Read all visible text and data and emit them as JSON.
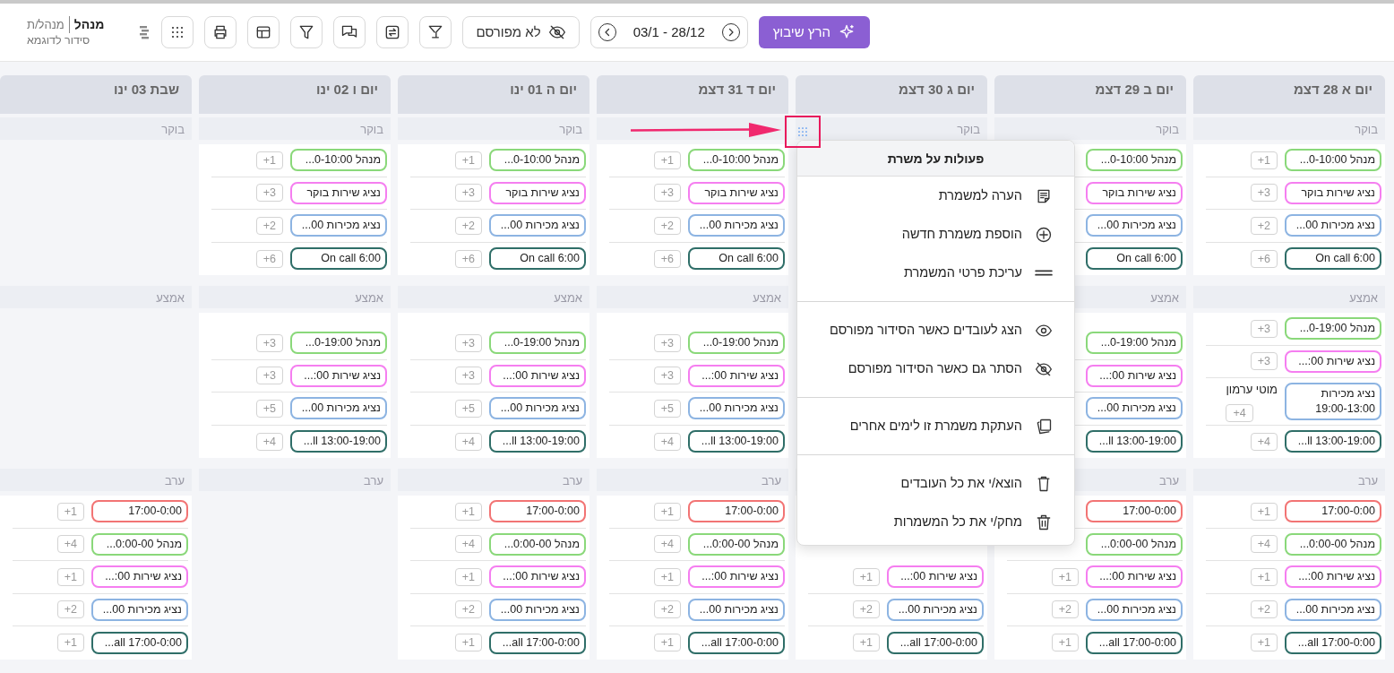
{
  "toolbar": [
    {
      "kind": "primary",
      "label": "הרץ שיבוץ"
    },
    {
      "kind": "date-range",
      "label": "03/1 - 28/12"
    },
    {
      "kind": "publish",
      "label": "לא מפורסם"
    },
    {
      "kind": "goblet-filter"
    },
    {
      "kind": "swap"
    },
    {
      "kind": "chat"
    },
    {
      "kind": "filter"
    },
    {
      "kind": "layout"
    },
    {
      "kind": "print"
    },
    {
      "kind": "apps"
    }
  ],
  "user": {
    "name": "מנהל",
    "role": "מנהל/ת",
    "schedule": "סידור לדוגמא"
  },
  "days": [
    {
      "title": "יום א 28 דצמ",
      "sections": [
        {
          "label": "בוקר",
          "shifts": [
            {
              "text": "מנהל 0-10:00...",
              "count": "+1",
              "color": "#8ad87a"
            },
            {
              "text": "נציג שירות בוקר",
              "count": "+3",
              "color": "#f57ef0"
            },
            {
              "text": "נציג מכירות 00...",
              "count": "+2",
              "color": "#8db4e2"
            },
            {
              "text": "On call 6:00",
              "count": "+6",
              "color": "#2f6e68"
            }
          ]
        },
        {
          "label": "אמצע",
          "shifts": [
            {
              "text": "מנהל 0-19:00...",
              "count": "+3",
              "color": "#8ad87a"
            },
            {
              "text": "נציג שירות 00:...",
              "count": "+3",
              "color": "#f57ef0"
            },
            {
              "text": "נציג מכירות 19:00-13:00",
              "staff": "מוטי ערמון",
              "count": "+4",
              "color": "#8db4e2"
            },
            {
              "text": "...ll 13:00-19:00",
              "count": "+4",
              "color": "#2f6e68"
            }
          ]
        },
        {
          "label": "ערב",
          "shifts": [
            {
              "text": "17:00-0:00",
              "count": "+1",
              "color": "#f27474"
            },
            {
              "text": "מנהל 0:00-00...",
              "count": "+4",
              "color": "#8ad87a"
            },
            {
              "text": "נציג שירות 00:...",
              "count": "+1",
              "color": "#f57ef0"
            },
            {
              "text": "נציג מכירות 00...",
              "count": "+2",
              "color": "#8db4e2"
            },
            {
              "text": "...all 17:00-0:00",
              "count": "+1",
              "color": "#2f6e68"
            }
          ]
        }
      ]
    },
    {
      "title": "יום ב 29 דצמ",
      "sections": [
        {
          "label": "בוקר",
          "shifts": [
            {
              "text": "מנהל 0-10:00...",
              "color": "#8ad87a"
            },
            {
              "text": "נציג שירות בוקר",
              "color": "#f57ef0"
            },
            {
              "text": "נציג מכירות 00...",
              "color": "#8db4e2"
            },
            {
              "text": "On call 6:00",
              "color": "#2f6e68"
            }
          ]
        },
        {
          "label": "אמצע",
          "shifts": [
            {
              "text": "מנהל 0-19:00...",
              "color": "#8ad87a"
            },
            {
              "text": "נציג שירות 00:...",
              "color": "#f57ef0"
            },
            {
              "text": "נציג מכירות 00...",
              "color": "#8db4e2"
            },
            {
              "text": "...ll 13:00-19:00",
              "color": "#2f6e68"
            }
          ]
        },
        {
          "label": "ערב",
          "shifts": [
            {
              "text": "17:00-0:00",
              "color": "#f27474"
            },
            {
              "text": "מנהל 0:00-00...",
              "color": "#8ad87a"
            },
            {
              "text": "נציג שירות 00:...",
              "count": "+1",
              "color": "#f57ef0"
            },
            {
              "text": "נציג מכירות 00...",
              "count": "+2",
              "color": "#8db4e2"
            },
            {
              "text": "...all 17:00-0:00",
              "count": "+1",
              "color": "#2f6e68"
            }
          ]
        }
      ]
    },
    {
      "title": "יום ג 30 דצמ",
      "sections": [
        {
          "label": "בוקר"
        },
        {
          "shifts": [
            {
              "text": "נציג שירות 00:...",
              "count": "+1",
              "color": "#f57ef0"
            },
            {
              "text": "נציג מכירות 00...",
              "count": "+2",
              "color": "#8db4e2"
            },
            {
              "text": "...all 17:00-0:00",
              "count": "+1",
              "color": "#2f6e68"
            }
          ]
        }
      ]
    },
    {
      "title": "יום ד 31 דצמ",
      "sections": [
        {
          "shifts": [
            {
              "text": "מנהל 0-10:00...",
              "count": "+1",
              "color": "#8ad87a"
            },
            {
              "text": "נציג שירות בוקר",
              "count": "+3",
              "color": "#f57ef0"
            },
            {
              "text": "נציג מכירות 00...",
              "count": "+2",
              "color": "#8db4e2"
            },
            {
              "text": "On call 6:00",
              "count": "+6",
              "color": "#2f6e68"
            }
          ]
        },
        {
          "label": "אמצע",
          "shifts": [
            {
              "text": "מנהל 0-19:00...",
              "count": "+3",
              "color": "#8ad87a"
            },
            {
              "text": "נציג שירות 00:...",
              "count": "+3",
              "color": "#f57ef0"
            },
            {
              "text": "נציג מכירות 00...",
              "count": "+5",
              "color": "#8db4e2"
            },
            {
              "text": "...ll 13:00-19:00",
              "count": "+4",
              "color": "#2f6e68"
            }
          ]
        },
        {
          "label": "ערב",
          "shifts": [
            {
              "text": "17:00-0:00",
              "count": "+1",
              "color": "#f27474"
            },
            {
              "text": "מנהל 0:00-00...",
              "count": "+4",
              "color": "#8ad87a"
            },
            {
              "text": "נציג שירות 00:...",
              "count": "+1",
              "color": "#f57ef0"
            },
            {
              "text": "נציג מכירות 00...",
              "count": "+2",
              "color": "#8db4e2"
            },
            {
              "text": "...all 17:00-0:00",
              "count": "+1",
              "color": "#2f6e68"
            }
          ]
        }
      ]
    },
    {
      "title": "יום ה 01 ינו",
      "sections": [
        {
          "label": "בוקר",
          "shifts": [
            {
              "text": "מנהל 0-10:00...",
              "count": "+1",
              "color": "#8ad87a"
            },
            {
              "text": "נציג שירות בוקר",
              "count": "+3",
              "color": "#f57ef0"
            },
            {
              "text": "נציג מכירות 00...",
              "count": "+2",
              "color": "#8db4e2"
            },
            {
              "text": "On call 6:00",
              "count": "+6",
              "color": "#2f6e68"
            }
          ]
        },
        {
          "label": "אמצע",
          "shifts": [
            {
              "text": "מנהל 0-19:00...",
              "count": "+3",
              "color": "#8ad87a"
            },
            {
              "text": "נציג שירות 00:...",
              "count": "+3",
              "color": "#f57ef0"
            },
            {
              "text": "נציג מכירות 00...",
              "count": "+5",
              "color": "#8db4e2"
            },
            {
              "text": "...ll 13:00-19:00",
              "count": "+4",
              "color": "#2f6e68"
            }
          ]
        },
        {
          "label": "ערב",
          "shifts": [
            {
              "text": "17:00-0:00",
              "count": "+1",
              "color": "#f27474"
            },
            {
              "text": "מנהל 0:00-00...",
              "count": "+4",
              "color": "#8ad87a"
            },
            {
              "text": "נציג שירות 00:...",
              "count": "+1",
              "color": "#f57ef0"
            },
            {
              "text": "נציג מכירות 00...",
              "count": "+2",
              "color": "#8db4e2"
            },
            {
              "text": "...all 17:00-0:00",
              "count": "+1",
              "color": "#2f6e68"
            }
          ]
        }
      ]
    },
    {
      "title": "יום ו 02 ינו",
      "sections": [
        {
          "label": "בוקר",
          "shifts": [
            {
              "text": "מנהל 0-10:00...",
              "count": "+1",
              "color": "#8ad87a"
            },
            {
              "text": "נציג שירות בוקר",
              "count": "+3",
              "color": "#f57ef0"
            },
            {
              "text": "נציג מכירות 00...",
              "count": "+2",
              "color": "#8db4e2"
            },
            {
              "text": "On call 6:00",
              "count": "+6",
              "color": "#2f6e68"
            }
          ]
        },
        {
          "label": "אמצע",
          "shifts": [
            {
              "text": "מנהל 0-19:00...",
              "count": "+3",
              "color": "#8ad87a"
            },
            {
              "text": "נציג שירות 00:...",
              "count": "+3",
              "color": "#f57ef0"
            },
            {
              "text": "נציג מכירות 00...",
              "count": "+5",
              "color": "#8db4e2"
            },
            {
              "text": "...ll 13:00-19:00",
              "count": "+4",
              "color": "#2f6e68"
            }
          ]
        },
        {
          "label": "ערב"
        }
      ]
    },
    {
      "title": "שבת 03 ינו",
      "sections": [
        {
          "label": "בוקר"
        },
        {
          "label": "אמצע"
        },
        {
          "label": "ערב",
          "shifts": [
            {
              "text": "17:00-0:00",
              "count": "+1",
              "color": "#f27474"
            },
            {
              "text": "מנהל 0:00-00...",
              "count": "+4",
              "color": "#8ad87a"
            },
            {
              "text": "נציג שירות 00:...",
              "count": "+1",
              "color": "#f57ef0"
            },
            {
              "text": "נציג מכירות 00...",
              "count": "+2",
              "color": "#8db4e2"
            },
            {
              "text": "...all 17:00-0:00",
              "count": "+1",
              "color": "#2f6e68"
            }
          ]
        }
      ]
    }
  ],
  "shift_menu": {
    "title": "פעולות על משרת",
    "groups": [
      [
        {
          "kind": "note",
          "label": "הערה למשמרת"
        },
        {
          "kind": "add",
          "label": "הוספת משמרת חדשה"
        },
        {
          "kind": "edit",
          "label": "עריכת פרטי המשמרת"
        }
      ],
      [
        {
          "kind": "show",
          "label": "הצג לעובדים כאשר הסידור מפורסם"
        },
        {
          "kind": "hide",
          "label": "הסתר גם כאשר הסידור מפורסם"
        }
      ],
      [
        {
          "kind": "copy",
          "label": "העתקת משמרת זו לימים אחרים"
        }
      ],
      [
        {
          "kind": "remove",
          "label": "הוצא/י את כל העובדים"
        },
        {
          "kind": "delete",
          "label": "מחק/י את כל המשמרות"
        }
      ]
    ]
  }
}
